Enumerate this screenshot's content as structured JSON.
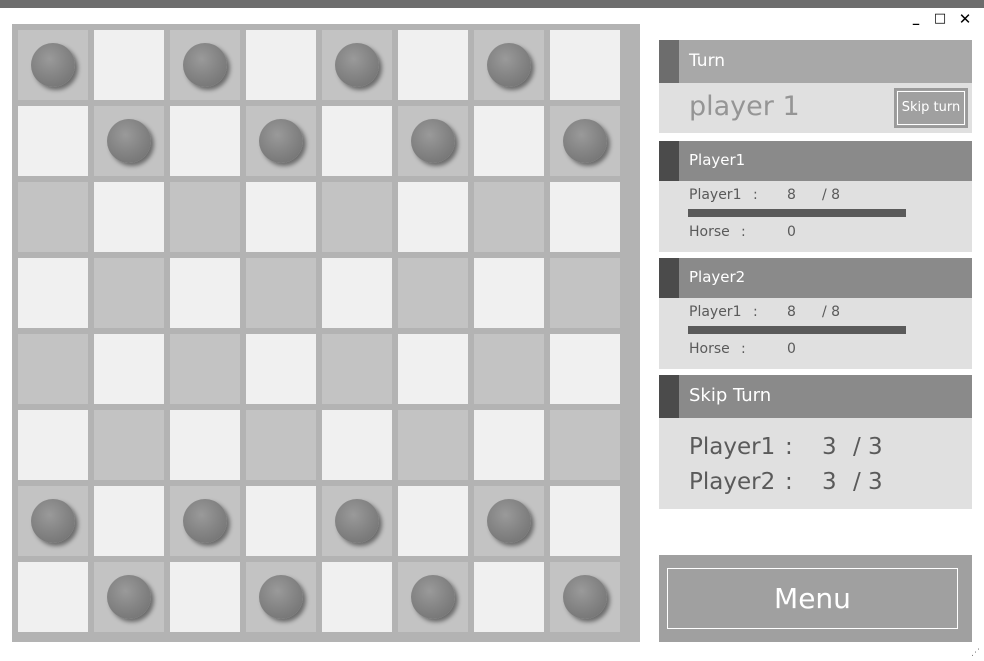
{
  "window": {
    "minimize": "_",
    "maximize": "□",
    "close": "✕"
  },
  "board": {
    "rows": 8,
    "cols": 8,
    "pieces": [
      [
        0,
        0
      ],
      [
        0,
        2
      ],
      [
        0,
        4
      ],
      [
        0,
        6
      ],
      [
        1,
        1
      ],
      [
        1,
        3
      ],
      [
        1,
        5
      ],
      [
        1,
        7
      ],
      [
        6,
        0
      ],
      [
        6,
        2
      ],
      [
        6,
        4
      ],
      [
        6,
        6
      ],
      [
        7,
        1
      ],
      [
        7,
        3
      ],
      [
        7,
        5
      ],
      [
        7,
        7
      ]
    ]
  },
  "turn": {
    "title": "Turn",
    "current": "player 1",
    "skip_button": "Skip turn"
  },
  "player1_panel": {
    "title": "Player1",
    "stat_label": "Player1",
    "colon": ":",
    "current": "8",
    "max": "/ 8",
    "hp_fraction": 1.0,
    "horse_label": "Horse",
    "horse_value": "0"
  },
  "player2_panel": {
    "title": "Player2",
    "stat_label": "Player1",
    "colon": ":",
    "current": "8",
    "max": "/ 8",
    "hp_fraction": 1.0,
    "horse_label": "Horse",
    "horse_value": "0"
  },
  "skip_turn": {
    "title": "Skip Turn",
    "rows": [
      {
        "label": "Player1",
        "colon": ":",
        "current": "3",
        "max": "/ 3"
      },
      {
        "label": "Player2",
        "colon": ":",
        "current": "3",
        "max": "/ 3"
      }
    ]
  },
  "menu": {
    "label": "Menu"
  }
}
